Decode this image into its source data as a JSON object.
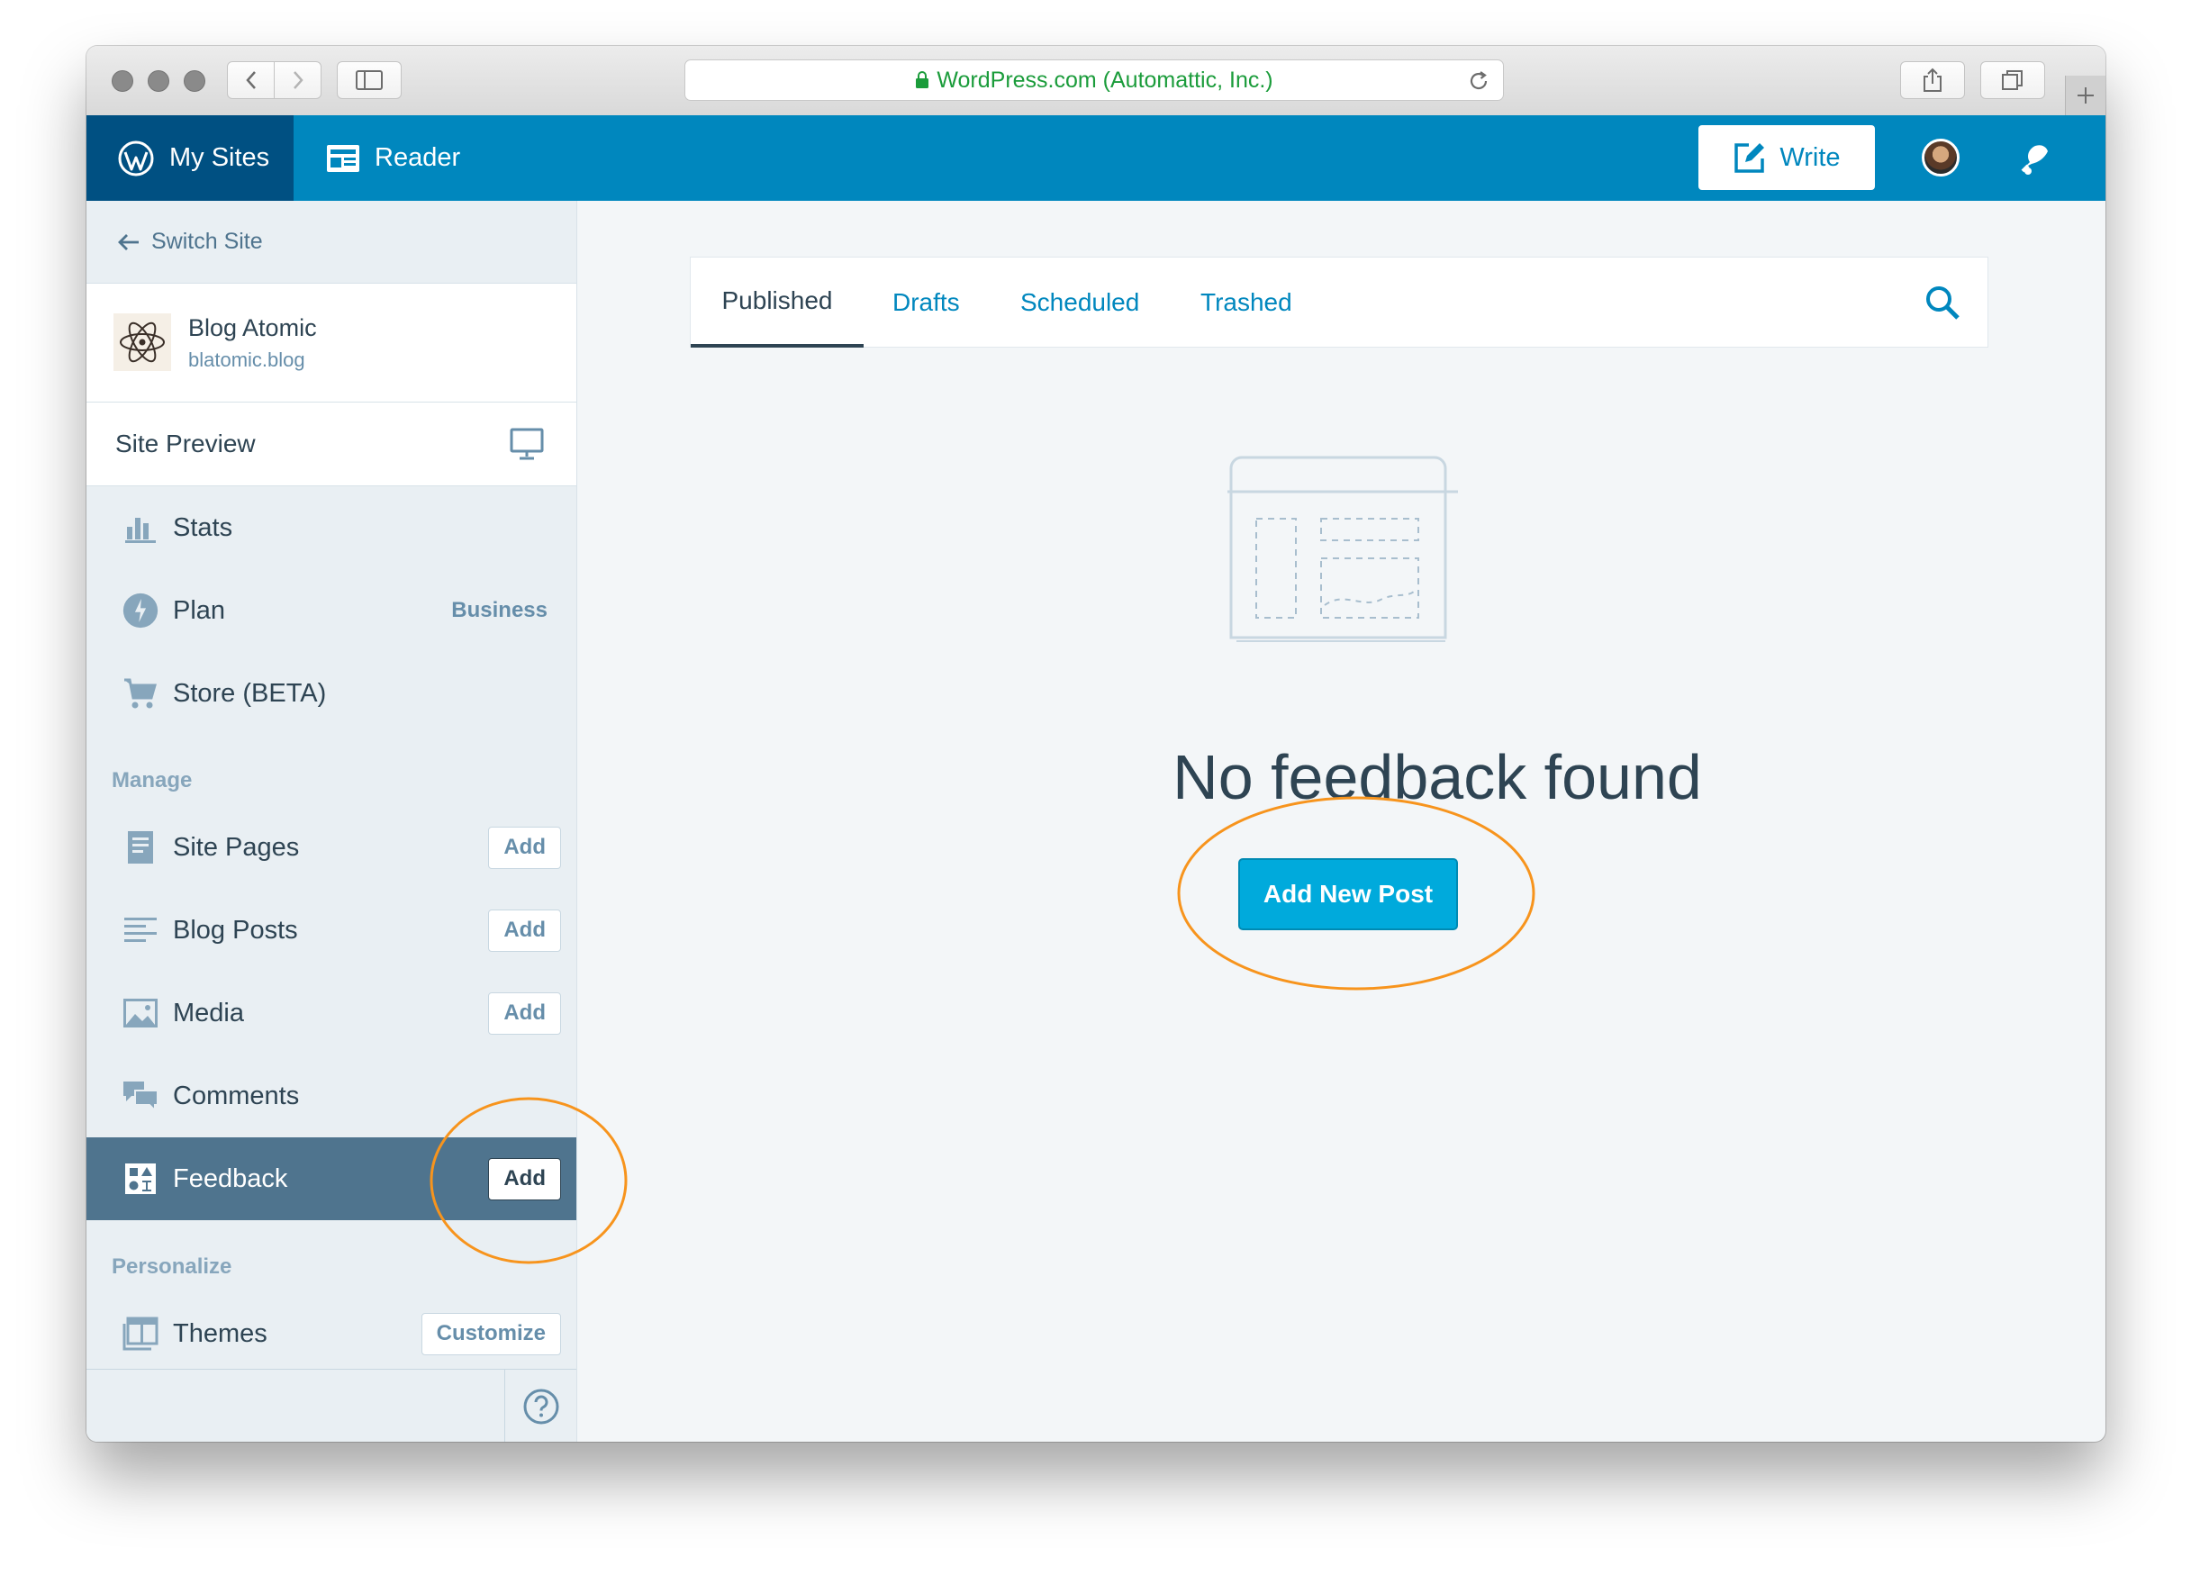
{
  "browser": {
    "url_text": "WordPress.com (Automattic, Inc.)"
  },
  "masterbar": {
    "my_sites": "My Sites",
    "reader": "Reader",
    "write": "Write"
  },
  "sidebar": {
    "switch_site": "Switch Site",
    "site": {
      "name": "Blog Atomic",
      "url": "blatomic.blog"
    },
    "site_preview": "Site Preview",
    "items_top": [
      {
        "label": "Stats",
        "icon": "stats-icon"
      },
      {
        "label": "Plan",
        "icon": "plan-icon",
        "badge": "Business"
      },
      {
        "label": "Store (BETA)",
        "icon": "cart-icon"
      }
    ],
    "manage_heading": "Manage",
    "manage": [
      {
        "label": "Site Pages",
        "icon": "pages-icon",
        "action": "Add"
      },
      {
        "label": "Blog Posts",
        "icon": "posts-icon",
        "action": "Add"
      },
      {
        "label": "Media",
        "icon": "media-icon",
        "action": "Add"
      },
      {
        "label": "Comments",
        "icon": "comments-icon"
      },
      {
        "label": "Feedback",
        "icon": "feedback-icon",
        "action": "Add",
        "selected": true
      }
    ],
    "personalize_heading": "Personalize",
    "personalize": [
      {
        "label": "Themes",
        "icon": "themes-icon",
        "action": "Customize"
      }
    ]
  },
  "main": {
    "tabs": [
      {
        "label": "Published",
        "active": true
      },
      {
        "label": "Drafts"
      },
      {
        "label": "Scheduled"
      },
      {
        "label": "Trashed"
      }
    ],
    "empty_title": "No feedback found",
    "add_new_post": "Add New Post"
  },
  "colors": {
    "masterbar": "#0087be",
    "my_sites_bg": "#005082",
    "selected_item": "#4f748e",
    "primary_button": "#00aadc",
    "annotation": "#f7941d"
  }
}
